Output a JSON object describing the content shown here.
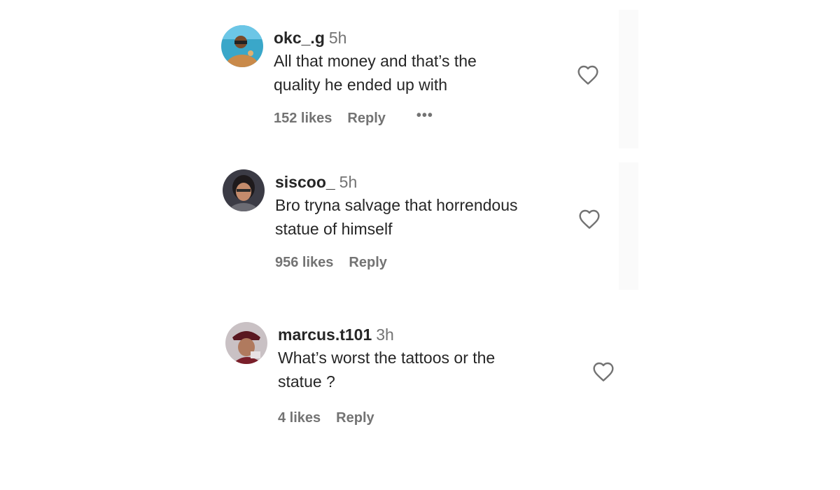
{
  "comments": [
    {
      "username": "okc_.g",
      "time": "5h",
      "text_line1": "All that money and that’s the",
      "text_line2": "quality he ended up with",
      "likes": "152 likes",
      "reply": "Reply",
      "more": "•••",
      "avatar_colors": {
        "bg": "#3aa7c9",
        "accent": "#d8a15a"
      }
    },
    {
      "username": "siscoo_",
      "time": "5h",
      "text_line1": "Bro tryna salvage that horrendous",
      "text_line2": "statue of himself",
      "likes": "956 likes",
      "reply": "Reply",
      "avatar_colors": {
        "bg": "#3b3b45",
        "accent": "#c48b6c"
      }
    },
    {
      "username": "marcus.t101",
      "time": "3h",
      "text_line1": "What’s worst the tattoos or the",
      "text_line2": "statue ?",
      "likes": "4 likes",
      "reply": "Reply",
      "avatar_colors": {
        "bg": "#c9c1c4",
        "accent": "#7a1f2a"
      }
    }
  ],
  "icons": {
    "like": "heart-outline-icon",
    "more": "more-options-icon"
  }
}
